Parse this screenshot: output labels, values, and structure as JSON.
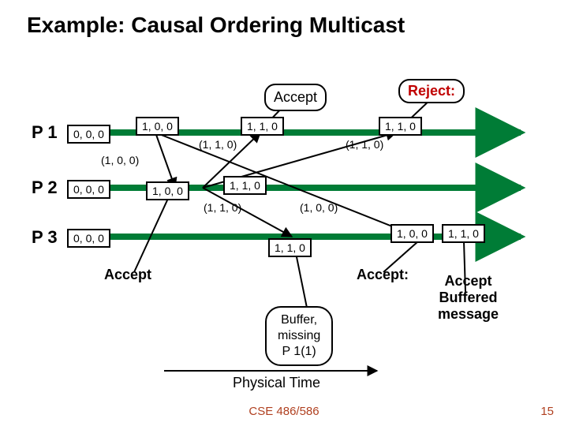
{
  "title": "Example: Causal Ordering Multicast",
  "labels": {
    "accept_top": "Accept",
    "reject": "Reject:",
    "accept_left": "Accept",
    "accept_right": "Accept:",
    "buffer": "Buffer,\nmissing\nP 1(1)",
    "accept_buffered": "Accept\nBuffered\nmessage",
    "physical_time": "Physical Time"
  },
  "processes": {
    "p1": "P 1",
    "p2": "P 2",
    "p3": "P 3"
  },
  "vectors": {
    "p1_init": "0, 0, 0",
    "p1_s1": "1, 0, 0",
    "p1_s2": "1, 1, 0",
    "p1_s3": "1, 1, 0",
    "p2_init": "0, 0, 0",
    "p2_m1": "1, 0, 0",
    "p2_m2": "1, 1, 0",
    "p3_init": "0, 0, 0",
    "p3_mid": "1, 1, 0",
    "p3_r1": "1, 0, 0",
    "p3_r2": "1, 1, 0"
  },
  "msgs": {
    "m100_a": "(1, 0, 0)",
    "m110_a": "(1, 1, 0)",
    "m110_b": "(1, 1, 0)",
    "m100_b": "(1, 0, 0)",
    "m110_c": "(1, 1, 0)"
  },
  "footer": "CSE 486/586",
  "slide": "15",
  "chart_data": {
    "type": "table",
    "title": "Causal Ordering Multicast timeline",
    "processes": [
      "P1",
      "P2",
      "P3"
    ],
    "initial_vectors": {
      "P1": [
        0,
        0,
        0
      ],
      "P2": [
        0,
        0,
        0
      ],
      "P3": [
        0,
        0,
        0
      ]
    },
    "events": [
      {
        "at": "P1",
        "type": "multicast",
        "vector": [
          1,
          0,
          0
        ]
      },
      {
        "at": "P2",
        "type": "deliver",
        "from": "P1",
        "msg_vector": [
          1,
          0,
          0
        ],
        "result": "accept",
        "local_vector": [
          1,
          0,
          0
        ]
      },
      {
        "at": "P2",
        "type": "multicast",
        "vector": [
          1,
          1,
          0
        ]
      },
      {
        "at": "P1",
        "type": "deliver",
        "from": "P2",
        "msg_vector": [
          1,
          1,
          0
        ],
        "result": "accept",
        "local_vector": [
          1,
          1,
          0
        ]
      },
      {
        "at": "P1",
        "type": "deliver",
        "from": "P2",
        "msg_vector": [
          1,
          1,
          0
        ],
        "result": "reject",
        "local_vector": [
          1,
          1,
          0
        ]
      },
      {
        "at": "P3",
        "type": "deliver",
        "from": "P2",
        "msg_vector": [
          1,
          1,
          0
        ],
        "result": "buffer",
        "reason": "missing P1(1)",
        "local_vector": [
          1,
          1,
          0
        ]
      },
      {
        "at": "P3",
        "type": "deliver",
        "from": "P1",
        "msg_vector": [
          1,
          0,
          0
        ],
        "result": "accept",
        "local_vector": [
          1,
          0,
          0
        ]
      },
      {
        "at": "P3",
        "type": "deliver_buffered",
        "msg_vector": [
          1,
          1,
          0
        ],
        "result": "accept",
        "local_vector": [
          1,
          1,
          0
        ]
      }
    ]
  }
}
